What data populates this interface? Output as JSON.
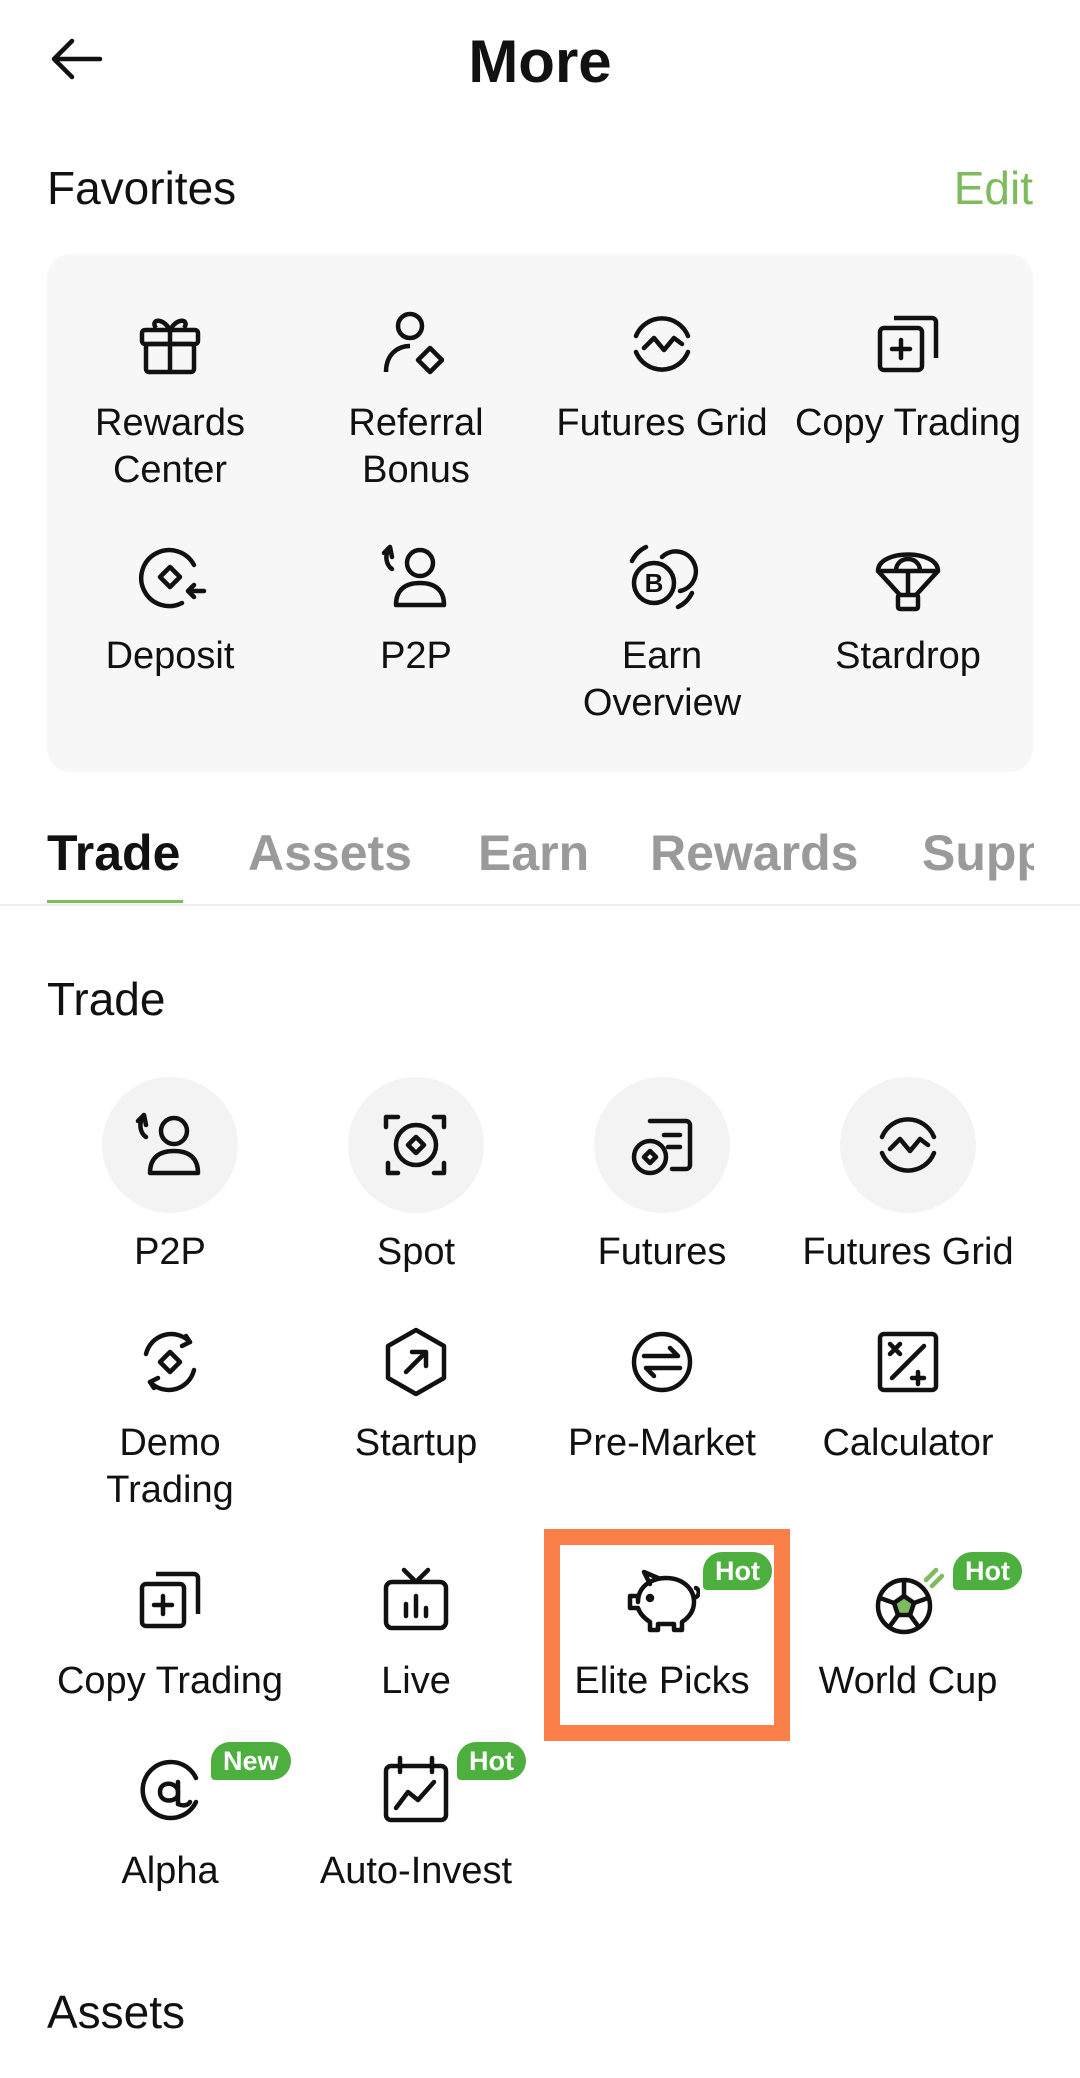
{
  "header": {
    "title": "More"
  },
  "favorites": {
    "title": "Favorites",
    "edit_label": "Edit",
    "items": [
      {
        "label": "Rewards\nCenter",
        "icon": "gift-icon"
      },
      {
        "label": "Referral\nBonus",
        "icon": "referral-icon"
      },
      {
        "label": "Futures Grid",
        "icon": "futures-grid-icon"
      },
      {
        "label": "Copy Trading",
        "icon": "copy-trading-icon"
      },
      {
        "label": "Deposit",
        "icon": "deposit-icon"
      },
      {
        "label": "P2P",
        "icon": "p2p-icon"
      },
      {
        "label": "Earn\nOverview",
        "icon": "earn-icon"
      },
      {
        "label": "Stardrop",
        "icon": "parachute-icon"
      }
    ]
  },
  "tabs": [
    {
      "label": "Trade",
      "active": true
    },
    {
      "label": "Assets"
    },
    {
      "label": "Earn"
    },
    {
      "label": "Rewards"
    },
    {
      "label": "Supp"
    }
  ],
  "trade": {
    "title": "Trade",
    "items": [
      {
        "label": "P2P",
        "icon": "p2p-icon"
      },
      {
        "label": "Spot",
        "icon": "spot-icon"
      },
      {
        "label": "Futures",
        "icon": "futures-icon"
      },
      {
        "label": "Futures Grid",
        "icon": "futures-grid-icon"
      },
      {
        "label": "Demo\nTrading",
        "icon": "demo-trading-icon"
      },
      {
        "label": "Startup",
        "icon": "startup-icon"
      },
      {
        "label": "Pre-Market",
        "icon": "pre-market-icon"
      },
      {
        "label": "Calculator",
        "icon": "calculator-icon"
      },
      {
        "label": "Copy Trading",
        "icon": "copy-trading-icon"
      },
      {
        "label": "Live",
        "icon": "live-tv-icon"
      },
      {
        "label": "Elite Picks",
        "icon": "piggy-bank-icon",
        "badge": "Hot"
      },
      {
        "label": "World Cup",
        "icon": "soccer-ball-icon",
        "badge": "Hot"
      },
      {
        "label": "Alpha",
        "icon": "alpha-icon",
        "badge": "New"
      },
      {
        "label": "Auto-Invest",
        "icon": "auto-invest-icon",
        "badge": "Hot"
      }
    ]
  },
  "assets": {
    "title": "Assets"
  },
  "colors": {
    "accent": "#7dbb5e",
    "badge": "#4caf3e",
    "highlight": "#fb7f48"
  }
}
